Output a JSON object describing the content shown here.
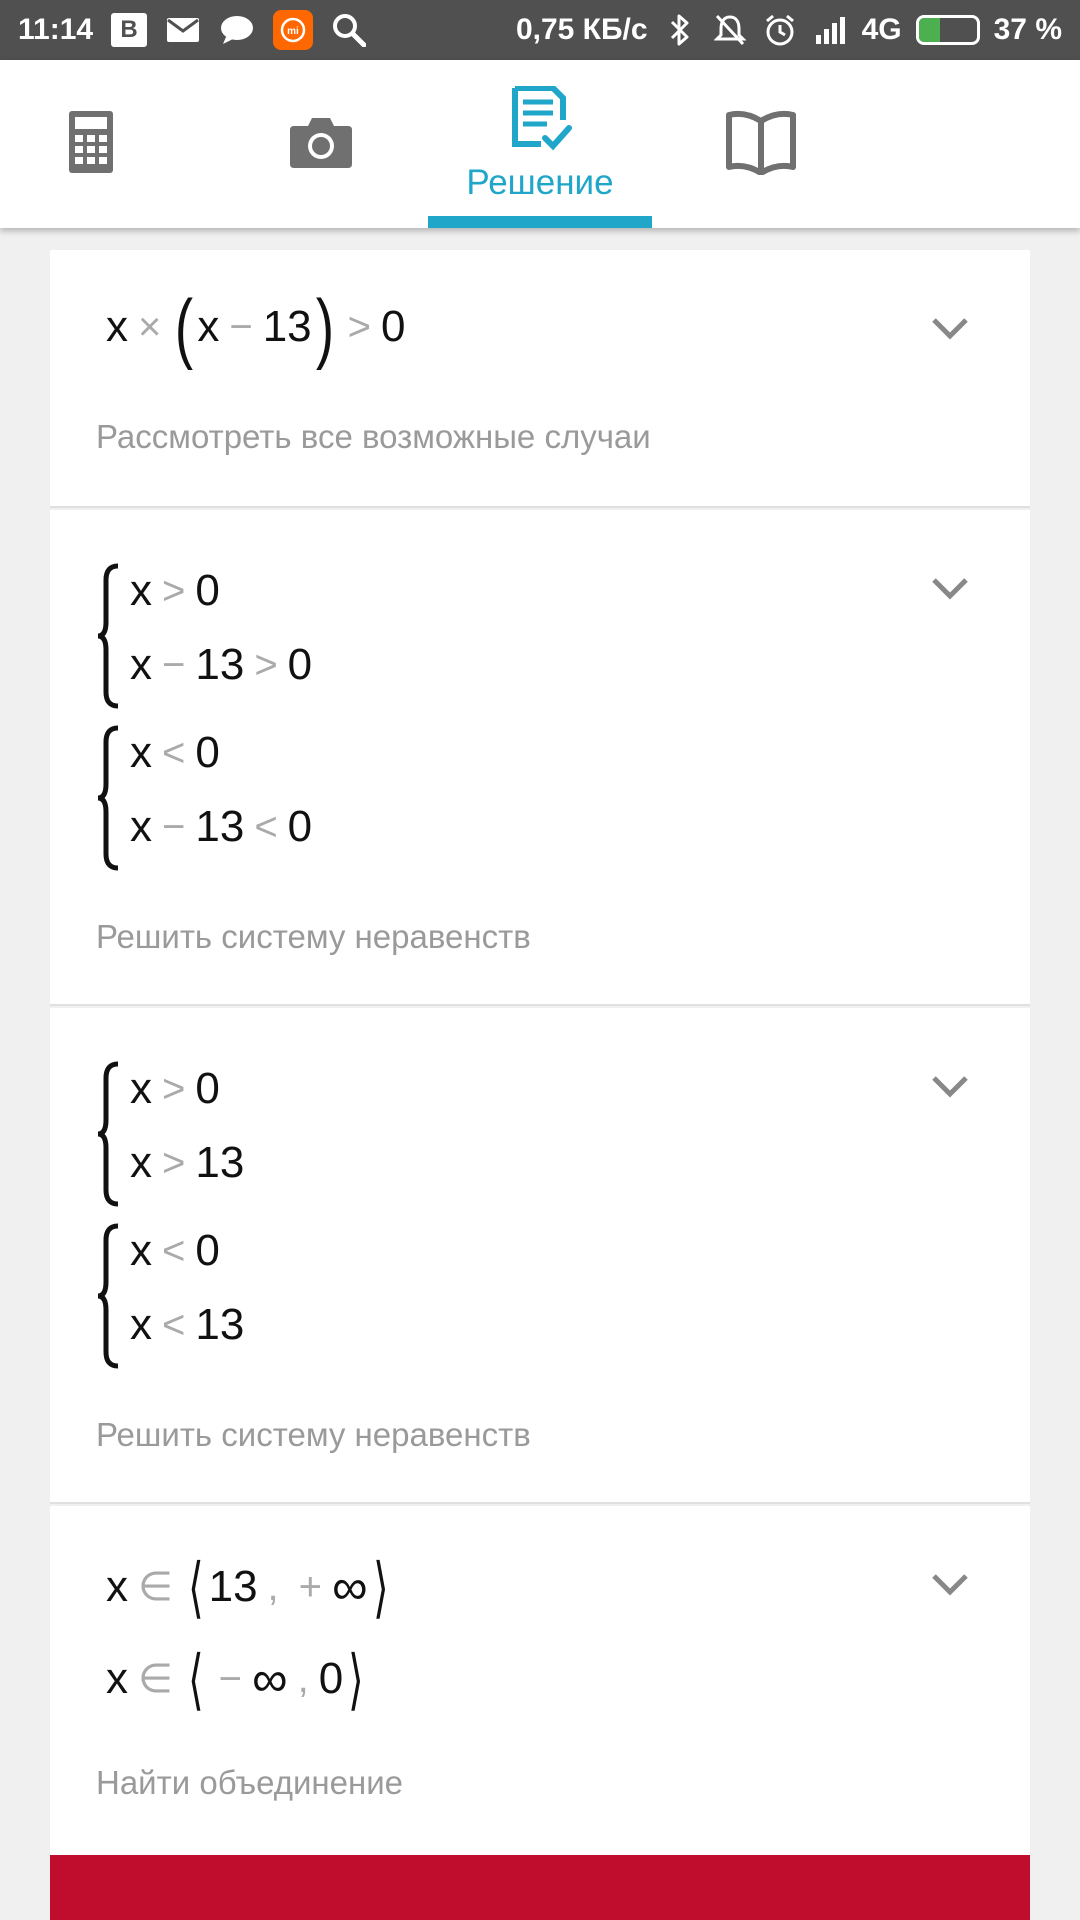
{
  "status_bar": {
    "time": "11:14",
    "vk_label": "B",
    "network_speed": "0,75 КБ/с",
    "network_type": "4G",
    "battery": "37 %",
    "battery_level": 0.37,
    "icons": [
      "vk-icon",
      "mail-icon",
      "chat-icon",
      "mi-icon",
      "search-icon",
      "bluetooth-icon",
      "bell-off-icon",
      "alarm-icon",
      "signal-icon",
      "battery-charging-icon"
    ]
  },
  "tabs": [
    {
      "name": "calculator-tab",
      "icon": "calculator-icon",
      "label": ""
    },
    {
      "name": "camera-tab",
      "icon": "camera-icon",
      "label": ""
    },
    {
      "name": "solution-tab",
      "icon": "solution-checklist-icon",
      "label": "Решение",
      "active": true
    },
    {
      "name": "book-tab",
      "icon": "book-icon",
      "label": ""
    }
  ],
  "accent_color": "#1fa6c9",
  "steps": [
    {
      "expr": {
        "a": "x",
        "times": "×",
        "b": "x",
        "minus": "−",
        "c": "13",
        "gt": ">",
        "d": "0"
      },
      "hint": "Рассмотреть все возможные случаи"
    },
    {
      "systems": [
        {
          "r1": {
            "a": "x",
            "op": ">",
            "b": "0"
          },
          "r2": {
            "a": "x",
            "minus": "−",
            "b": "13",
            "op": ">",
            "c": "0"
          }
        },
        {
          "r1": {
            "a": "x",
            "op": "<",
            "b": "0"
          },
          "r2": {
            "a": "x",
            "minus": "−",
            "b": "13",
            "op": "<",
            "c": "0"
          }
        }
      ],
      "hint": "Решить систему неравенств"
    },
    {
      "systems": [
        {
          "r1": {
            "a": "x",
            "op": ">",
            "b": "0"
          },
          "r2": {
            "a": "x",
            "op": ">",
            "b": "13"
          }
        },
        {
          "r1": {
            "a": "x",
            "op": "<",
            "b": "0"
          },
          "r2": {
            "a": "x",
            "op": "<",
            "b": "13"
          }
        }
      ],
      "hint": "Решить систему неравенств"
    },
    {
      "lines": [
        {
          "x": "x",
          "in": "∈",
          "lo": "13",
          "comma": ",",
          "plus": "+",
          "hi": "∞"
        },
        {
          "x": "x",
          "in": "∈",
          "minus": "−",
          "lo": "∞",
          "comma": ",",
          "hi": "0"
        }
      ],
      "hint": "Найти объединение"
    }
  ],
  "result_bar_color": "#c00d2d"
}
